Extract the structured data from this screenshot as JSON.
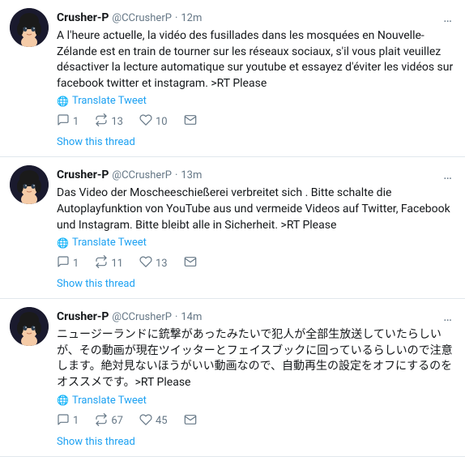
{
  "tweets": [
    {
      "id": "tweet-1",
      "display_name": "Crusher-P",
      "username": "@CCrusherP",
      "time": "12m",
      "text": "A l'heure actuelle, la vidéo des fusillades dans les mosquées en Nouvelle-Zélande est en train de tourner sur les réseaux sociaux, s'il vous plait veuillez désactiver la lecture automatique sur youtube et essayez d'éviter les vidéos sur facebook twitter et instagram. >RT Please",
      "translate_label": "Translate Tweet",
      "reply_count": "1",
      "retweet_count": "13",
      "like_count": "10",
      "show_thread_label": "Show this thread"
    },
    {
      "id": "tweet-2",
      "display_name": "Crusher-P",
      "username": "@CCrusherP",
      "time": "13m",
      "text": "Das Video der Moscheeschießerei verbreitet sich . Bitte schalte die Autoplayfunktion von YouTube aus und vermeide Videos auf Twitter, Facebook und Instagram. Bitte bleibt alle in Sicherheit. >RT Please",
      "translate_label": "Translate Tweet",
      "reply_count": "1",
      "retweet_count": "11",
      "like_count": "13",
      "show_thread_label": "Show this thread"
    },
    {
      "id": "tweet-3",
      "display_name": "Crusher-P",
      "username": "@CCrusherP",
      "time": "14m",
      "text": "ニュージーランドに銃撃があったみたいで犯人が全部生放送していたらしいが、その動画が現在ツイッターとフェイスブックに回っているらしいので注意します。絶対見ないほうがいい動画なので、自動再生の設定をオフにするのをオススメです。>RT Please",
      "translate_label": "Translate Tweet",
      "reply_count": "1",
      "retweet_count": "67",
      "like_count": "45",
      "show_thread_label": "Show this thread"
    }
  ],
  "icons": {
    "globe": "🌐",
    "reply": "💬",
    "retweet": "🔁",
    "like": "🤍",
    "dm": "✉",
    "more": "…"
  }
}
